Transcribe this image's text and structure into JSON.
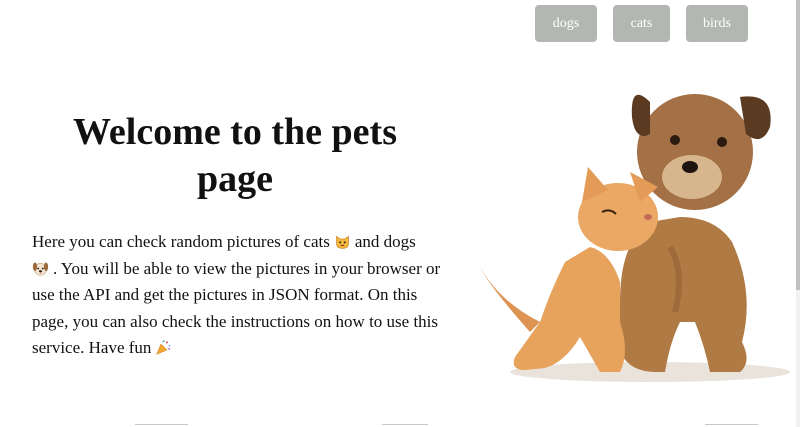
{
  "nav": {
    "buttons": [
      "dogs",
      "cats",
      "birds"
    ]
  },
  "hero": {
    "title": "Welcome to the pets page",
    "intro_part1": "Here you can check random pictures of cats",
    "intro_part2": "and dogs",
    "intro_part3": ". You will be able to view the pictures in your browser or use the API and get the pictures in JSON format. On this page, you can also check the instructions on how to use this service. Have fun",
    "icons": [
      "cat-face-emoji-icon",
      "dog-face-emoji-icon",
      "party-popper-emoji-icon"
    ]
  },
  "image": {
    "subject": "puppy-and-kitten-photo"
  },
  "colors": {
    "nav_button_bg": "#b3b7b2",
    "nav_button_text": "#ffffff",
    "text": "#111111"
  }
}
